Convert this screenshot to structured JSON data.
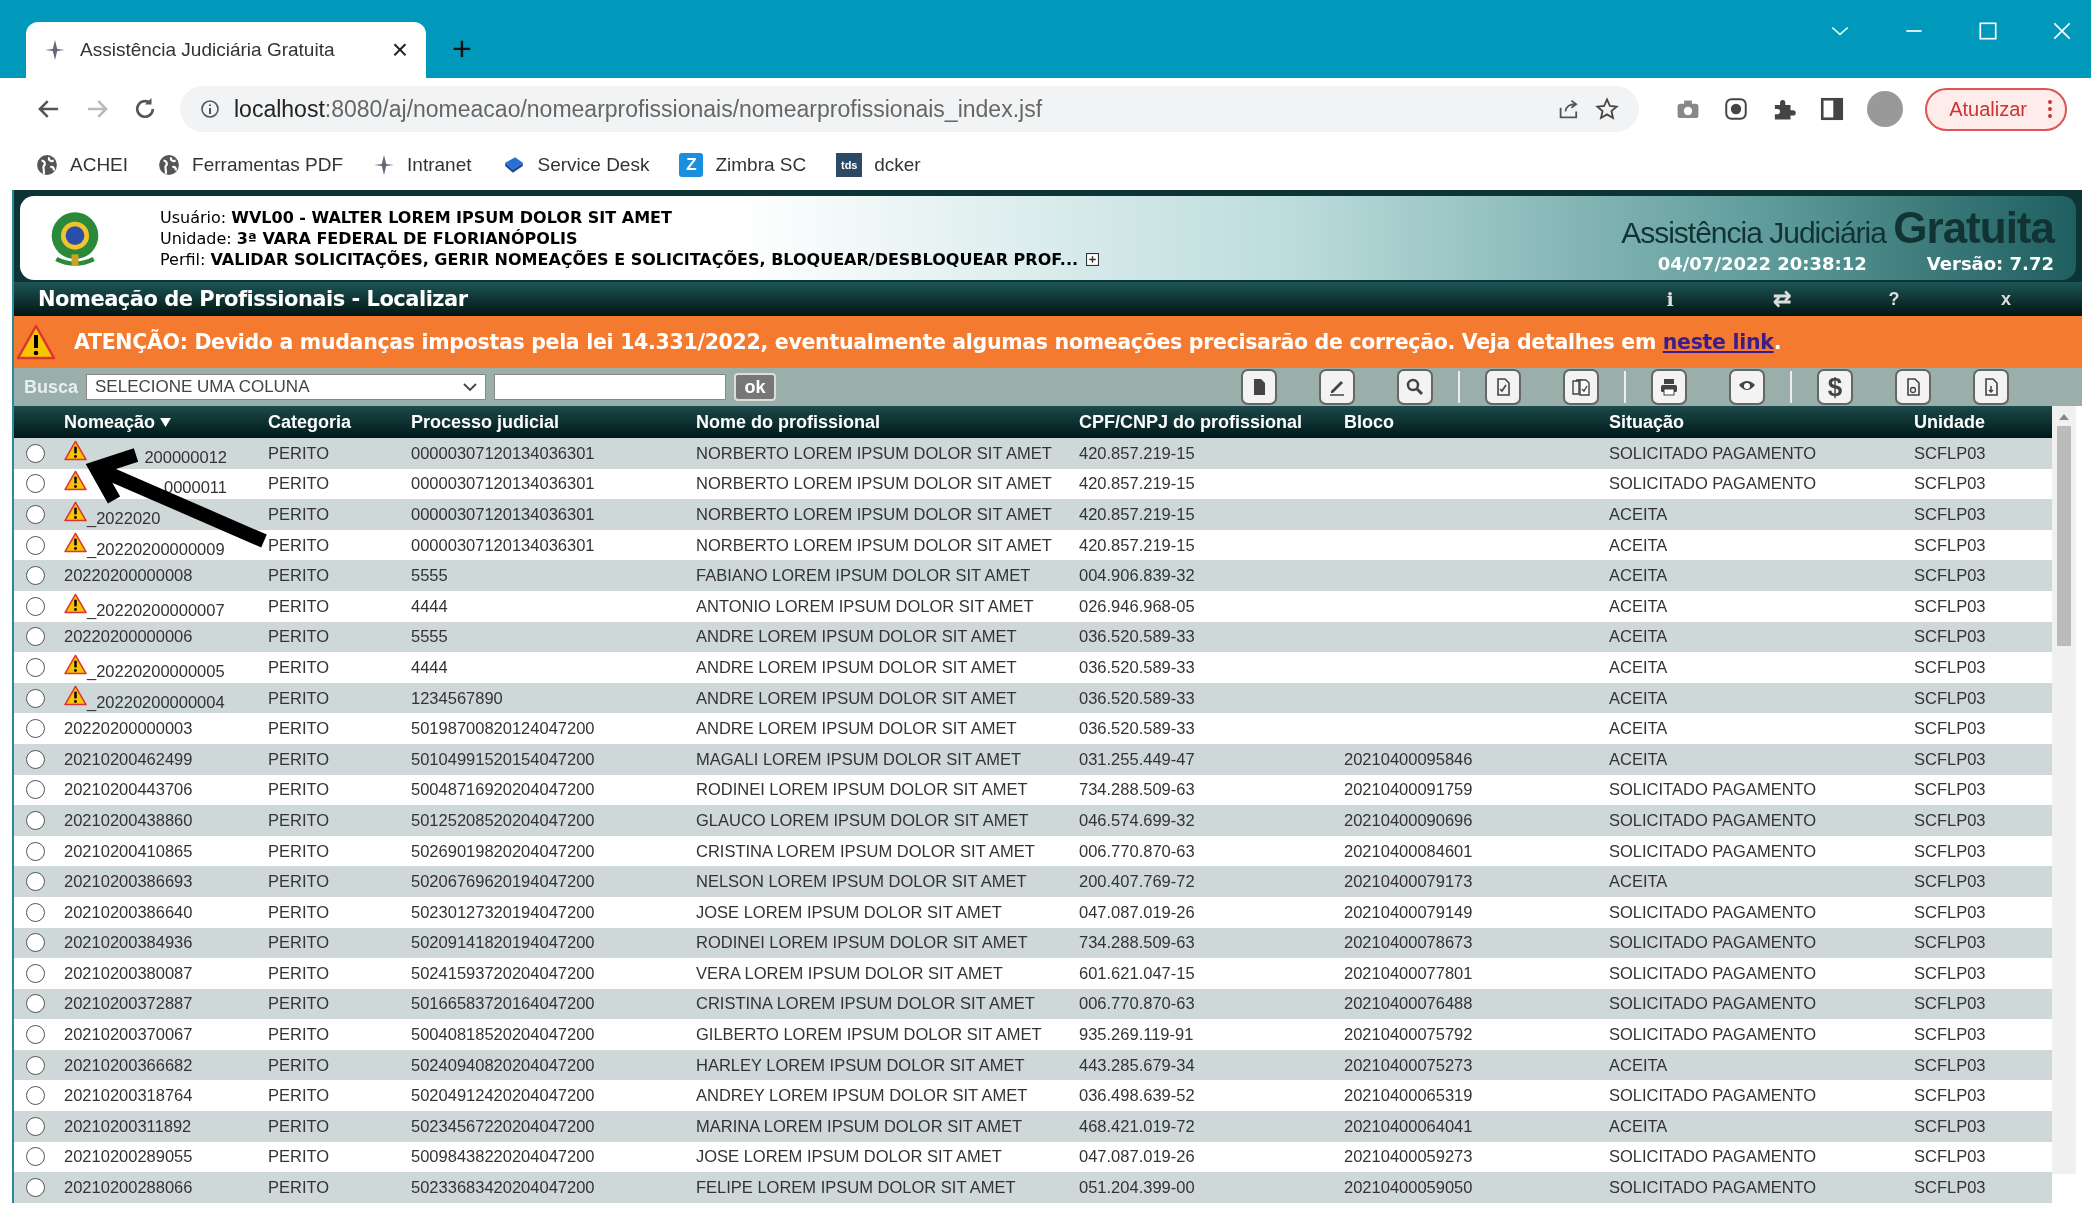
{
  "browser": {
    "tab_title": "Assistência Judiciária Gratuita",
    "tab_close": "×",
    "new_tab": "+",
    "url": {
      "host": "localhost",
      "path": ":8080/aj/nomeacao/nomearprofissionais/nomearprofissionais_index.jsf"
    },
    "update_button": "Atualizar",
    "bookmarks": [
      {
        "kind": "globe",
        "label": "ACHEI"
      },
      {
        "kind": "globe",
        "label": "Ferramentas PDF"
      },
      {
        "kind": "pinwheel",
        "label": "Intranet"
      },
      {
        "kind": "book",
        "label": "Service Desk"
      },
      {
        "kind": "letter",
        "badge": "Z",
        "label": "Zimbra SC"
      },
      {
        "kind": "letter-dark",
        "badge": "tds",
        "label": "dcker"
      }
    ]
  },
  "header": {
    "user_lines": [
      "Usuário: **WVL00 - WALTER LOREM IPSUM DOLOR SIT AMET**",
      "Unidade: **3ª VARA FEDERAL DE FLORIANÓPOLIS**",
      "Perfil: **VALIDAR SOLICITAÇÕES, GERIR NOMEAÇÕES E SOLICITAÇÕES, BLOQUEAR/DESBLOQUEAR PROF...**"
    ],
    "brand": "Assistência Judiciária",
    "brand_big": "Gratuita",
    "datetime": "04/07/2022 20:38:12",
    "version": "Versão: 7.72"
  },
  "title_bar": {
    "title": "Nomeação de Profissionais - Localizar",
    "actions": [
      {
        "kind": "info",
        "text": "i"
      },
      {
        "kind": "swap",
        "text": "⇄"
      },
      {
        "kind": "help",
        "text": "?"
      },
      {
        "kind": "close",
        "text": "x"
      }
    ]
  },
  "warning": {
    "text": "ATENÇÃO: Devido a mudanças impostas pela lei 14.331/2022, eventualmente algumas nomeações precisarão de correção. Veja detalhes em ",
    "link": "neste link",
    "after": "."
  },
  "search": {
    "label": "Busca",
    "column_select": "SELECIONE UMA COLUNA",
    "button": "ok"
  },
  "toolbar": [
    [
      {
        "kind": "document"
      },
      {
        "kind": "edit"
      },
      {
        "kind": "search"
      }
    ],
    [
      {
        "kind": "doc-check"
      },
      {
        "kind": "docs-check"
      }
    ],
    [
      {
        "kind": "print"
      },
      {
        "kind": "eye"
      }
    ],
    [
      {
        "kind": "glyph",
        "text": "$"
      },
      {
        "kind": "doc-seal"
      },
      {
        "kind": "doc-down"
      }
    ]
  ],
  "table": {
    "columns": [
      {
        "label": "Nomeação",
        "sorted": true
      },
      {
        "label": "Categoria",
        "sorted": false
      },
      {
        "label": "Processo judicial",
        "sorted": false
      },
      {
        "label": "Nome do profissional",
        "sorted": false
      },
      {
        "label": "CPF/CNPJ do profissional",
        "sorted": false
      },
      {
        "label": "Bloco",
        "sorted": false
      },
      {
        "label": "Situação",
        "sorted": false
      },
      {
        "label": "Unidade",
        "sorted": false
      }
    ],
    "rows": [
      {
        "selected": false,
        "warning": true,
        "nomeacao": "200000012",
        "categoria": "PERITO",
        "processo": "00000307120134036301",
        "nome": "NORBERTO LOREM IPSUM DOLOR SIT AMET",
        "cpf": "420.857.219-15",
        "situacao": "SOLICITADO PAGAMENTO",
        "unidade": "SCFLP03"
      },
      {
        "selected": false,
        "warning": true,
        "nomeacao": "0000011",
        "categoria": "PERITO",
        "processo": "00000307120134036301",
        "nome": "NORBERTO LOREM IPSUM DOLOR SIT AMET",
        "cpf": "420.857.219-15",
        "situacao": "SOLICITADO PAGAMENTO",
        "unidade": "SCFLP03"
      },
      {
        "selected": false,
        "warning": true,
        "nomeacao": "_2022020",
        "categoria": "PERITO",
        "processo": "00000307120134036301",
        "nome": "NORBERTO LOREM IPSUM DOLOR SIT AMET",
        "cpf": "420.857.219-15",
        "situacao": "ACEITA",
        "unidade": "SCFLP03"
      },
      {
        "selected": false,
        "warning": true,
        "nomeacao": "_20220200000009",
        "categoria": "PERITO",
        "processo": "00000307120134036301",
        "nome": "NORBERTO LOREM IPSUM DOLOR SIT AMET",
        "cpf": "420.857.219-15",
        "situacao": "ACEITA",
        "unidade": "SCFLP03"
      },
      {
        "selected": false,
        "warning": false,
        "nomeacao": "20220200000008",
        "categoria": "PERITO",
        "processo": "5555",
        "nome": "FABIANO LOREM IPSUM DOLOR SIT AMET",
        "cpf": "004.906.839-32",
        "situacao": "ACEITA",
        "unidade": "SCFLP03"
      },
      {
        "selected": false,
        "warning": true,
        "nomeacao": "_20220200000007",
        "categoria": "PERITO",
        "processo": "4444",
        "nome": "ANTONIO LOREM IPSUM DOLOR SIT AMET",
        "cpf": "026.946.968-05",
        "situacao": "ACEITA",
        "unidade": "SCFLP03"
      },
      {
        "selected": false,
        "warning": false,
        "nomeacao": "20220200000006",
        "categoria": "PERITO",
        "processo": "5555",
        "nome": "ANDRE LOREM IPSUM DOLOR SIT AMET",
        "cpf": "036.520.589-33",
        "situacao": "ACEITA",
        "unidade": "SCFLP03"
      },
      {
        "selected": false,
        "warning": true,
        "nomeacao": "_20220200000005",
        "categoria": "PERITO",
        "processo": "4444",
        "nome": "ANDRE LOREM IPSUM DOLOR SIT AMET",
        "cpf": "036.520.589-33",
        "situacao": "ACEITA",
        "unidade": "SCFLP03"
      },
      {
        "selected": false,
        "warning": true,
        "nomeacao": "_20220200000004",
        "categoria": "PERITO",
        "processo": "1234567890",
        "nome": "ANDRE LOREM IPSUM DOLOR SIT AMET",
        "cpf": "036.520.589-33",
        "situacao": "ACEITA",
        "unidade": "SCFLP03"
      },
      {
        "selected": false,
        "warning": false,
        "nomeacao": "20220200000003",
        "categoria": "PERITO",
        "processo": "50198700820124047200",
        "nome": "ANDRE LOREM IPSUM DOLOR SIT AMET",
        "cpf": "036.520.589-33",
        "situacao": "ACEITA",
        "unidade": "SCFLP03"
      },
      {
        "selected": false,
        "warning": false,
        "nomeacao": "20210200462499",
        "categoria": "PERITO",
        "processo": "50104991520154047200",
        "nome": "MAGALI LOREM IPSUM DOLOR SIT AMET",
        "cpf": "031.255.449-47",
        "bloco": "20210400095846",
        "situacao": "ACEITA",
        "unidade": "SCFLP03"
      },
      {
        "selected": false,
        "warning": false,
        "nomeacao": "20210200443706",
        "categoria": "PERITO",
        "processo": "50048716920204047200",
        "nome": "RODINEI LOREM IPSUM DOLOR SIT AMET",
        "cpf": "734.288.509-63",
        "bloco": "20210400091759",
        "situacao": "SOLICITADO PAGAMENTO",
        "unidade": "SCFLP03"
      },
      {
        "selected": false,
        "warning": false,
        "nomeacao": "20210200438860",
        "categoria": "PERITO",
        "processo": "50125208520204047200",
        "nome": "GLAUCO LOREM IPSUM DOLOR SIT AMET",
        "cpf": "046.574.699-32",
        "bloco": "20210400090696",
        "situacao": "SOLICITADO PAGAMENTO",
        "unidade": "SCFLP03"
      },
      {
        "selected": false,
        "warning": false,
        "nomeacao": "20210200410865",
        "categoria": "PERITO",
        "processo": "50269019820204047200",
        "nome": "CRISTINA LOREM IPSUM DOLOR SIT AMET",
        "cpf": "006.770.870-63",
        "bloco": "20210400084601",
        "situacao": "SOLICITADO PAGAMENTO",
        "unidade": "SCFLP03"
      },
      {
        "selected": false,
        "warning": false,
        "nomeacao": "20210200386693",
        "categoria": "PERITO",
        "processo": "50206769620194047200",
        "nome": "NELSON LOREM IPSUM DOLOR SIT AMET",
        "cpf": "200.407.769-72",
        "bloco": "20210400079173",
        "situacao": "ACEITA",
        "unidade": "SCFLP03"
      },
      {
        "selected": false,
        "warning": false,
        "nomeacao": "20210200386640",
        "categoria": "PERITO",
        "processo": "50230127320194047200",
        "nome": "JOSE LOREM IPSUM DOLOR SIT AMET",
        "cpf": "047.087.019-26",
        "bloco": "20210400079149",
        "situacao": "SOLICITADO PAGAMENTO",
        "unidade": "SCFLP03"
      },
      {
        "selected": false,
        "warning": false,
        "nomeacao": "20210200384936",
        "categoria": "PERITO",
        "processo": "50209141820194047200",
        "nome": "RODINEI LOREM IPSUM DOLOR SIT AMET",
        "cpf": "734.288.509-63",
        "bloco": "20210400078673",
        "situacao": "SOLICITADO PAGAMENTO",
        "unidade": "SCFLP03"
      },
      {
        "selected": false,
        "warning": false,
        "nomeacao": "20210200380087",
        "categoria": "PERITO",
        "processo": "50241593720204047200",
        "nome": "VERA LOREM IPSUM DOLOR SIT AMET",
        "cpf": "601.621.047-15",
        "bloco": "20210400077801",
        "situacao": "SOLICITADO PAGAMENTO",
        "unidade": "SCFLP03"
      },
      {
        "selected": false,
        "warning": false,
        "nomeacao": "20210200372887",
        "categoria": "PERITO",
        "processo": "50166583720164047200",
        "nome": "CRISTINA LOREM IPSUM DOLOR SIT AMET",
        "cpf": "006.770.870-63",
        "bloco": "20210400076488",
        "situacao": "SOLICITADO PAGAMENTO",
        "unidade": "SCFLP03"
      },
      {
        "selected": false,
        "warning": false,
        "nomeacao": "20210200370067",
        "categoria": "PERITO",
        "processo": "50040818520204047200",
        "nome": "GILBERTO LOREM IPSUM DOLOR SIT AMET",
        "cpf": "935.269.119-91",
        "bloco": "20210400075792",
        "situacao": "SOLICITADO PAGAMENTO",
        "unidade": "SCFLP03"
      },
      {
        "selected": false,
        "warning": false,
        "nomeacao": "20210200366682",
        "categoria": "PERITO",
        "processo": "50240940820204047200",
        "nome": "HARLEY LOREM IPSUM DOLOR SIT AMET",
        "cpf": "443.285.679-34",
        "bloco": "20210400075273",
        "situacao": "ACEITA",
        "unidade": "SCFLP03"
      },
      {
        "selected": false,
        "warning": false,
        "nomeacao": "20210200318764",
        "categoria": "PERITO",
        "processo": "50204912420204047200",
        "nome": "ANDREY LOREM IPSUM DOLOR SIT AMET",
        "cpf": "036.498.639-52",
        "bloco": "20210400065319",
        "situacao": "SOLICITADO PAGAMENTO",
        "unidade": "SCFLP03"
      },
      {
        "selected": false,
        "warning": false,
        "nomeacao": "20210200311892",
        "categoria": "PERITO",
        "processo": "50234567220204047200",
        "nome": "MARINA LOREM IPSUM DOLOR SIT AMET",
        "cpf": "468.421.019-72",
        "bloco": "20210400064041",
        "situacao": "ACEITA",
        "unidade": "SCFLP03"
      },
      {
        "selected": false,
        "warning": false,
        "nomeacao": "20210200289055",
        "categoria": "PERITO",
        "processo": "50098438220204047200",
        "nome": "JOSE LOREM IPSUM DOLOR SIT AMET",
        "cpf": "047.087.019-26",
        "bloco": "20210400059273",
        "situacao": "SOLICITADO PAGAMENTO",
        "unidade": "SCFLP03"
      },
      {
        "selected": false,
        "warning": false,
        "nomeacao": "20210200288066",
        "categoria": "PERITO",
        "processo": "50233683420204047200",
        "nome": "FELIPE LOREM IPSUM DOLOR SIT AMET",
        "cpf": "051.204.399-00",
        "bloco": "20210400059050",
        "situacao": "SOLICITADO PAGAMENTO",
        "unidade": "SCFLP03"
      }
    ]
  }
}
